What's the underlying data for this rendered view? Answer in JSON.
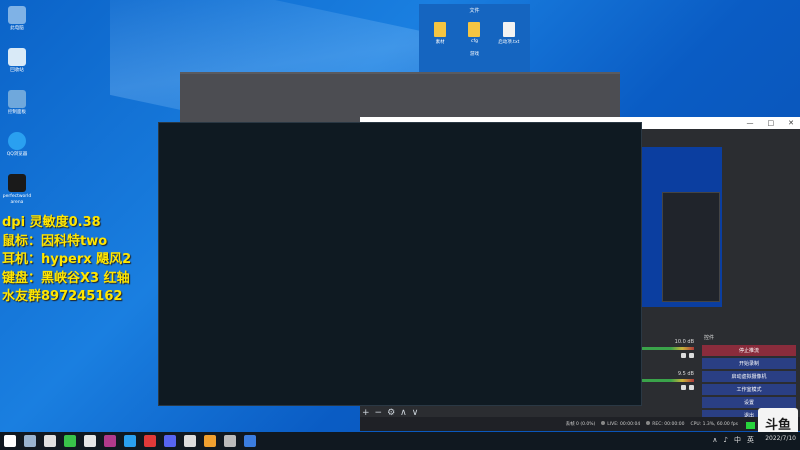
{
  "desktop": {
    "icons": [
      {
        "label": "此电脑",
        "icon": "computer-icon",
        "color": "#7fb2e6"
      },
      {
        "label": "回收站",
        "icon": "recycle-bin-icon",
        "color": "#d9eaf7"
      },
      {
        "label": "控制面板",
        "icon": "control-panel-icon",
        "color": "#6fa8dc"
      },
      {
        "label": "QQ浏览器",
        "icon": "browser-icon",
        "color": "#2aa0f0"
      },
      {
        "label": "perfectworld arena",
        "icon": "arena-icon",
        "color": "#1a1a1a"
      }
    ]
  },
  "overlay": {
    "lines": [
      "dpi 灵敏度0.38",
      "鼠标：因科特two",
      "耳机：hyperx 飓风2",
      "键盘：黑峡谷X3 红轴",
      "水友群897245162"
    ]
  },
  "explorer": {
    "title": "文件",
    "files": [
      {
        "name": "素材",
        "icon": "folder-icon"
      },
      {
        "name": "cfg",
        "icon": "folder-icon"
      },
      {
        "name": "启动项.txt",
        "icon": "text-file-icon"
      }
    ],
    "subtitle": "游戏"
  },
  "obs": {
    "window_controls": [
      "—",
      "□",
      "✕"
    ],
    "controls_title": "控件",
    "buttons": [
      "停止推流",
      "开始录制",
      "启动虚拟摄像机",
      "工作室模式",
      "设置",
      "退出"
    ],
    "mixer": [
      {
        "db": "10.0 dB"
      },
      {
        "db": "9.5 dB"
      }
    ],
    "status": {
      "dropped": "丢帧 0 (0.0%)",
      "live": "LIVE: 00:00:04",
      "rec": "REC: 00:00:00",
      "cpu": "CPU: 1.3%, 60.00 fps"
    }
  },
  "toolbar": [
    "+",
    "−",
    "⚙",
    "∧",
    "∨"
  ],
  "logo": {
    "text": "斗鱼",
    "caption": "2022/7/10"
  },
  "taskbar": {
    "icons": [
      {
        "icon": "start-icon",
        "color": "#ffffff"
      },
      {
        "icon": "steam-icon",
        "color": "#9ab4d0"
      },
      {
        "icon": "people-icon",
        "color": "#e0e0e0"
      },
      {
        "icon": "wechat-icon",
        "color": "#39c34a"
      },
      {
        "icon": "qq-icon",
        "color": "#e6e6e6"
      },
      {
        "icon": "app-icon",
        "color": "#b23a8c"
      },
      {
        "icon": "browser-icon",
        "color": "#2aa0f0"
      },
      {
        "icon": "netease-icon",
        "color": "#e23a3a"
      },
      {
        "icon": "discord-icon",
        "color": "#5865f2"
      },
      {
        "icon": "obs-icon",
        "color": "#dddddd"
      },
      {
        "icon": "steam-client-icon",
        "color": "#f0a030"
      },
      {
        "icon": "chat-icon",
        "color": "#bbbbbb"
      },
      {
        "icon": "qq-browser-icon",
        "color": "#3b7de0"
      }
    ],
    "tray": [
      "∧",
      "♪",
      "中",
      "英"
    ],
    "clock": "2022/7/10"
  }
}
